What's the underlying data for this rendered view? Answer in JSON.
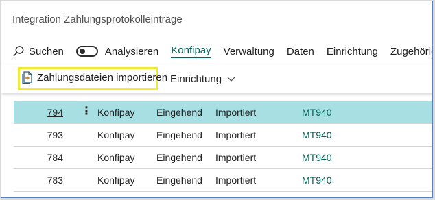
{
  "page": {
    "title": "Integration Zahlungsprotokolleinträge"
  },
  "actionbar": {
    "search_label": "Suchen",
    "analyze_label": "Analysieren",
    "tabs": [
      "Konfipay",
      "Verwaltung",
      "Daten",
      "Einrichtung",
      "Zugehörig"
    ],
    "active_tab": "Konfipay"
  },
  "subbar": {
    "import_label": "Zahlungsdateien importieren",
    "setup_label": "Einrichtung"
  },
  "rows": [
    {
      "no": "794",
      "provider": "Konfipay",
      "direction": "Eingehend",
      "status": "Importiert",
      "format": "MT940"
    },
    {
      "no": "793",
      "provider": "Konfipay",
      "direction": "Eingehend",
      "status": "Importiert",
      "format": "MT940"
    },
    {
      "no": "784",
      "provider": "Konfipay",
      "direction": "Eingehend",
      "status": "Importiert",
      "format": "MT940"
    },
    {
      "no": "783",
      "provider": "Konfipay",
      "direction": "Eingehend",
      "status": "Importiert",
      "format": "MT940"
    }
  ],
  "colors": {
    "accent": "#00645a",
    "selected_row": "#a8dfe3",
    "highlight_box": "#f0ea34"
  }
}
